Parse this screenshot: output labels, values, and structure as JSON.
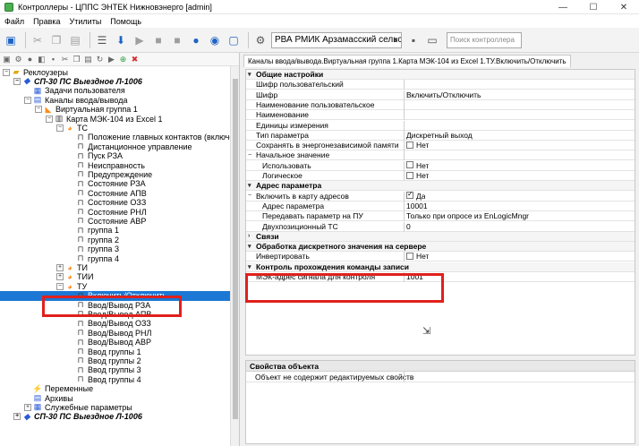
{
  "window": {
    "title": "Контроллеры - ЦППС ЭНТЕК Нижновэнерго [admin]",
    "min": "—",
    "max": "☐",
    "close": "✕"
  },
  "menu": [
    "Файл",
    "Правка",
    "Утилиты",
    "Помощь"
  ],
  "toolbar": {
    "project_combo": "РВА РМИК Арзамасский сельск",
    "search_placeholder": "Поиск контроллера"
  },
  "tree": {
    "nodes": [
      {
        "label": "Реклоузеры",
        "icon": "folder-icon"
      },
      {
        "label": "СП-30 ПС Выездное Л-1006",
        "icon": "blue-icon"
      },
      {
        "label": "Задачи пользователя",
        "icon": "tasks-icon"
      },
      {
        "label": "Каналы ввода/вывода",
        "icon": "channels-icon"
      },
      {
        "label": "Виртуальная группа 1",
        "icon": "group-icon"
      },
      {
        "label": "Карта МЭК-104 из Excel 1",
        "icon": "map-icon"
      },
      {
        "label": "ТС",
        "icon": "ts-icon"
      },
      {
        "label": "Положение главных контактов (включен)",
        "icon": "signal-icon"
      },
      {
        "label": "Дистанционное управление",
        "icon": "signal-icon"
      },
      {
        "label": "Пуск РЗА",
        "icon": "signal-icon"
      },
      {
        "label": "Неисправность",
        "icon": "signal-icon"
      },
      {
        "label": "Предупреждение",
        "icon": "signal-icon"
      },
      {
        "label": "Состояние РЗА",
        "icon": "signal-icon"
      },
      {
        "label": "Состояние АПВ",
        "icon": "signal-icon"
      },
      {
        "label": "Состояние ОЗЗ",
        "icon": "signal-icon"
      },
      {
        "label": "Состояние РНЛ",
        "icon": "signal-icon"
      },
      {
        "label": "Состояние АВР",
        "icon": "signal-icon"
      },
      {
        "label": "группа 1",
        "icon": "signal-icon"
      },
      {
        "label": "группа 2",
        "icon": "signal-icon"
      },
      {
        "label": "группа 3",
        "icon": "signal-icon"
      },
      {
        "label": "группа 4",
        "icon": "signal-icon"
      },
      {
        "label": "ТИ",
        "icon": "ti-icon"
      },
      {
        "label": "ТИИ",
        "icon": "tii-icon"
      },
      {
        "label": "ТУ",
        "icon": "tu-icon"
      },
      {
        "label": "Включить/Отключить",
        "icon": "signal-icon"
      },
      {
        "label": "Ввод/Вывод РЗА",
        "icon": "signal-icon"
      },
      {
        "label": "Ввод/Вывод АПВ",
        "icon": "signal-icon"
      },
      {
        "label": "Ввод/Вывод ОЗЗ",
        "icon": "signal-icon"
      },
      {
        "label": "Ввод/Вывод РНЛ",
        "icon": "signal-icon"
      },
      {
        "label": "Ввод/Вывод АВР",
        "icon": "signal-icon"
      },
      {
        "label": "Ввод группы 1",
        "icon": "signal-icon"
      },
      {
        "label": "Ввод группы 2",
        "icon": "signal-icon"
      },
      {
        "label": "Ввод группы 3",
        "icon": "signal-icon"
      },
      {
        "label": "Ввод группы 4",
        "icon": "signal-icon"
      },
      {
        "label": "Переменные",
        "icon": "variables-icon"
      },
      {
        "label": "Архивы",
        "icon": "archive-icon"
      },
      {
        "label": "Служебные параметры",
        "icon": "service-icon"
      },
      {
        "label": "СП-30 ПС Выездное Л-1006",
        "icon": "blue-icon"
      }
    ]
  },
  "right": {
    "tab": "Каналы ввода/вывода.Виртуальная группа 1.Карта МЭК-104 из Excel 1.ТУ.Включить/Отключить",
    "rows": [
      {
        "type": "sec",
        "k": "Общие настройки",
        "tog": "▼"
      },
      {
        "k": "Шифр пользовательский",
        "v": ""
      },
      {
        "k": "Шифр",
        "v": "Включить/Отключить"
      },
      {
        "k": "Наименование пользовательское",
        "v": ""
      },
      {
        "k": "Наименование",
        "v": ""
      },
      {
        "k": "Единицы измерения",
        "v": ""
      },
      {
        "k": "Тип параметра",
        "v": "Дискретный выход"
      },
      {
        "k": "Сохранять в энергонезависимой памяти",
        "v": "Нет",
        "cb": false
      },
      {
        "k": "Начальное значение",
        "v": "",
        "tog": "⊟"
      },
      {
        "k": "Использовать",
        "v": "Нет",
        "cb": false,
        "ind": true
      },
      {
        "k": "Логическое",
        "v": "Нет",
        "cb": false,
        "ind": true
      },
      {
        "type": "sec",
        "k": "Адрес параметра",
        "tog": "▼"
      },
      {
        "k": "Включить в карту адресов",
        "v": "Да",
        "cb": true,
        "tog": "⊟"
      },
      {
        "k": "Адрес параметра",
        "v": "10001",
        "ind": true
      },
      {
        "k": "Передавать параметр на ПУ",
        "v": "Только при опросе из EnLogicMngr",
        "ind": true
      },
      {
        "k": "Двухпозиционный ТС",
        "v": "0",
        "ind": true
      },
      {
        "type": "sec",
        "k": "Связи",
        "tog": "▶"
      },
      {
        "type": "sec",
        "k": "Обработка дискретного значения на сервере",
        "tog": "▼"
      },
      {
        "k": "Инвертировать",
        "v": "Нет",
        "cb": false
      },
      {
        "type": "sec",
        "k": "Контроль прохождения команды записи",
        "tog": "▼"
      },
      {
        "k": "МЭК-адрес сигнала для контроля",
        "v": "1001"
      }
    ],
    "props_title": "Свойства объекта",
    "props_row": "Объект не содержит редактируемых свойств"
  },
  "colors": {
    "selection": "#1c78d4",
    "highlight": "#e0201c"
  }
}
